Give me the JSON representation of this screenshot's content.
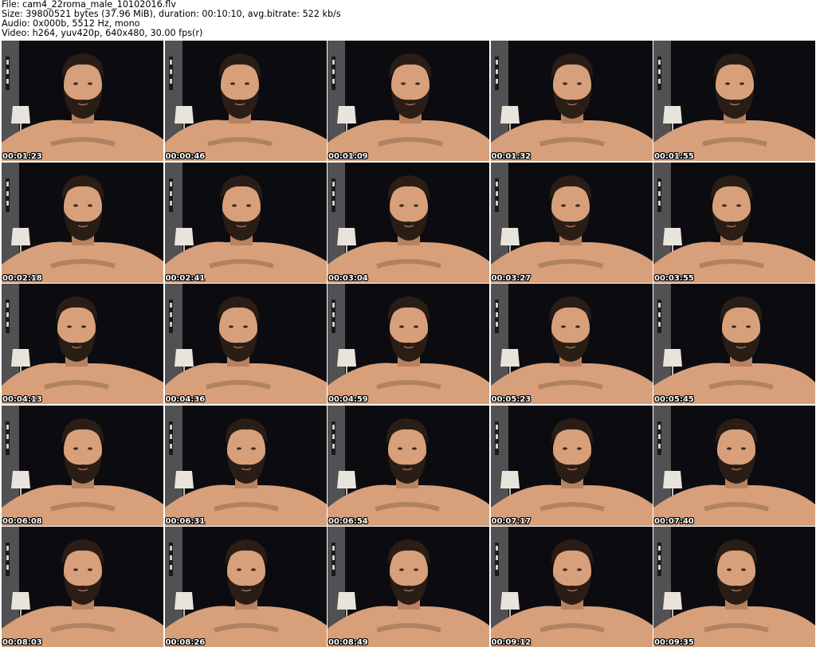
{
  "header": {
    "file_line": "File: cam4_22roma_male_10102016.flv",
    "size_line": "Size: 39800521 bytes (37.96 MiB), duration: 00:10:10, avg.bitrate: 522 kb/s",
    "audio_line": "Audio: 0x000b, 5512 Hz, mono",
    "video_line": "Video: h264, yuv420p, 640x480, 30.00 fps(r)"
  },
  "thumbnails": [
    {
      "timestamp": "00:01:23",
      "icon": "video-frame-thumbnail"
    },
    {
      "timestamp": "00:00:46",
      "icon": "video-frame-thumbnail"
    },
    {
      "timestamp": "00:01:09",
      "icon": "video-frame-thumbnail"
    },
    {
      "timestamp": "00:01:32",
      "icon": "video-frame-thumbnail"
    },
    {
      "timestamp": "00:01:55",
      "icon": "video-frame-thumbnail"
    },
    {
      "timestamp": "00:02:18",
      "icon": "video-frame-thumbnail"
    },
    {
      "timestamp": "00:02:41",
      "icon": "video-frame-thumbnail"
    },
    {
      "timestamp": "00:03:04",
      "icon": "video-frame-thumbnail"
    },
    {
      "timestamp": "00:03:27",
      "icon": "video-frame-thumbnail"
    },
    {
      "timestamp": "00:03:55",
      "icon": "video-frame-thumbnail"
    },
    {
      "timestamp": "00:04:13",
      "icon": "video-frame-thumbnail"
    },
    {
      "timestamp": "00:04:36",
      "icon": "video-frame-thumbnail"
    },
    {
      "timestamp": "00:04:59",
      "icon": "video-frame-thumbnail"
    },
    {
      "timestamp": "00:05:23",
      "icon": "video-frame-thumbnail"
    },
    {
      "timestamp": "00:05:45",
      "icon": "video-frame-thumbnail"
    },
    {
      "timestamp": "00:06:08",
      "icon": "video-frame-thumbnail"
    },
    {
      "timestamp": "00:06:31",
      "icon": "video-frame-thumbnail"
    },
    {
      "timestamp": "00:06:54",
      "icon": "video-frame-thumbnail"
    },
    {
      "timestamp": "00:07:17",
      "icon": "video-frame-thumbnail"
    },
    {
      "timestamp": "00:07:40",
      "icon": "video-frame-thumbnail"
    },
    {
      "timestamp": "00:08:03",
      "icon": "video-frame-thumbnail"
    },
    {
      "timestamp": "00:08:26",
      "icon": "video-frame-thumbnail"
    },
    {
      "timestamp": "00:08:49",
      "icon": "video-frame-thumbnail"
    },
    {
      "timestamp": "00:09:12",
      "icon": "video-frame-thumbnail"
    },
    {
      "timestamp": "00:09:35",
      "icon": "video-frame-thumbnail"
    }
  ],
  "colors": {
    "background_dark": "#0c0c10",
    "skin": "#d7a07a",
    "skin_shadow": "#b7825f",
    "hair": "#2a1d16",
    "lamp_shade": "#e8e4dc",
    "wall_left": "#8a8a8a",
    "timestamp_text": "#ffffff"
  }
}
